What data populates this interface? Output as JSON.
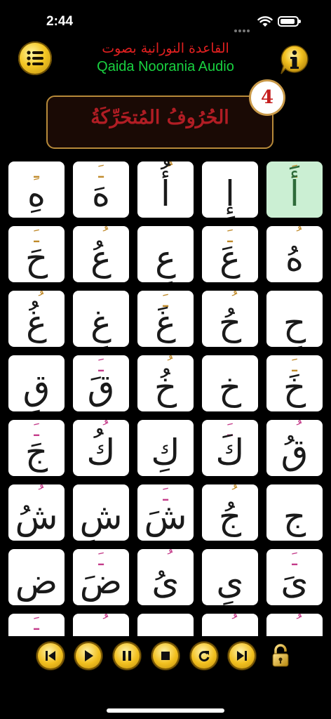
{
  "status_bar": {
    "time": "2:44"
  },
  "header": {
    "title_arabic": "القاعدة النورانية بصوت",
    "title_english": "Qaida Noorania Audio"
  },
  "lesson": {
    "number": "4",
    "title": "الحُرُوفُ المُتحَرِّكَةُ"
  },
  "letters": [
    {
      "mark": "ـِ",
      "base": "هِ",
      "mark_color": "#c08a2a",
      "active": false
    },
    {
      "mark": "ـَ",
      "base": "هَ",
      "mark_color": "#c08a2a",
      "active": false
    },
    {
      "mark": "ُ",
      "base": "أُ",
      "mark_color": "#c08a2a",
      "active": false
    },
    {
      "mark": "",
      "base": "إِ",
      "mark_color": "#c08a2a",
      "active": false
    },
    {
      "mark": "ـَ",
      "base": "أَ",
      "mark_color": "#c08a2a",
      "active": true
    },
    {
      "mark": "ـَ",
      "base": "حَ",
      "mark_color": "#c08a2a",
      "active": false
    },
    {
      "mark": "ُ",
      "base": "عُ",
      "mark_color": "#c08a2a",
      "active": false
    },
    {
      "mark": "",
      "base": "عِ",
      "mark_color": "#c08a2a",
      "active": false
    },
    {
      "mark": "ـَ",
      "base": "عَ",
      "mark_color": "#c08a2a",
      "active": false
    },
    {
      "mark": "ُ",
      "base": "هُ",
      "mark_color": "#c08a2a",
      "active": false
    },
    {
      "mark": "ُ",
      "base": "غُ",
      "mark_color": "#c08a2a",
      "active": false
    },
    {
      "mark": "",
      "base": "غِ",
      "mark_color": "#c08a2a",
      "active": false
    },
    {
      "mark": "ـَ",
      "base": "غَ",
      "mark_color": "#c08a2a",
      "active": false
    },
    {
      "mark": "ُ",
      "base": "حُ",
      "mark_color": "#c08a2a",
      "active": false
    },
    {
      "mark": "",
      "base": "حِ",
      "mark_color": "#c08a2a",
      "active": false
    },
    {
      "mark": "",
      "base": "قِ",
      "mark_color": "#c43c8a",
      "active": false
    },
    {
      "mark": "ـَ",
      "base": "قَ",
      "mark_color": "#c43c8a",
      "active": false
    },
    {
      "mark": "ُ",
      "base": "خُ",
      "mark_color": "#c08a2a",
      "active": false
    },
    {
      "mark": "",
      "base": "خِ",
      "mark_color": "#c08a2a",
      "active": false
    },
    {
      "mark": "ـَ",
      "base": "خَ",
      "mark_color": "#c08a2a",
      "active": false
    },
    {
      "mark": "ـَ",
      "base": "جَ",
      "mark_color": "#c43c8a",
      "active": false
    },
    {
      "mark": "ُ",
      "base": "كُ",
      "mark_color": "#c43c8a",
      "active": false
    },
    {
      "mark": "",
      "base": "كِ",
      "mark_color": "#c43c8a",
      "active": false
    },
    {
      "mark": "ـَ",
      "base": "كَ",
      "mark_color": "#c43c8a",
      "active": false
    },
    {
      "mark": "ُ",
      "base": "قُ",
      "mark_color": "#c43c8a",
      "active": false
    },
    {
      "mark": "ُ",
      "base": "شُ",
      "mark_color": "#c43c8a",
      "active": false
    },
    {
      "mark": "",
      "base": "شِ",
      "mark_color": "#c43c8a",
      "active": false
    },
    {
      "mark": "ـَ",
      "base": "شَ",
      "mark_color": "#c43c8a",
      "active": false
    },
    {
      "mark": "ُ",
      "base": "جُ",
      "mark_color": "#c08a2a",
      "active": false
    },
    {
      "mark": "",
      "base": "جِ",
      "mark_color": "#c08a2a",
      "active": false
    },
    {
      "mark": "",
      "base": "ضِ",
      "mark_color": "#c43c8a",
      "active": false
    },
    {
      "mark": "ـَ",
      "base": "ضَ",
      "mark_color": "#c43c8a",
      "active": false
    },
    {
      "mark": "ُ",
      "base": "ىُ",
      "mark_color": "#c43c8a",
      "active": false
    },
    {
      "mark": "",
      "base": "ىِ",
      "mark_color": "#c43c8a",
      "active": false
    },
    {
      "mark": "ـَ",
      "base": "ىَ",
      "mark_color": "#c43c8a",
      "active": false
    },
    {
      "mark": "ـَ",
      "base": "",
      "mark_color": "#c43c8a",
      "active": false
    },
    {
      "mark": "ُ",
      "base": "",
      "mark_color": "#c43c8a",
      "active": false
    },
    {
      "mark": "",
      "base": "",
      "mark_color": "#c43c8a",
      "active": false
    },
    {
      "mark": "ُ",
      "base": "",
      "mark_color": "#c43c8a",
      "active": false
    },
    {
      "mark": "ُ",
      "base": "",
      "mark_color": "#c43c8a",
      "active": false
    }
  ],
  "controls": {
    "icons": [
      "skip-previous-icon",
      "play-icon",
      "pause-icon",
      "stop-icon",
      "repeat-icon",
      "skip-next-icon",
      "lock-icon"
    ]
  }
}
